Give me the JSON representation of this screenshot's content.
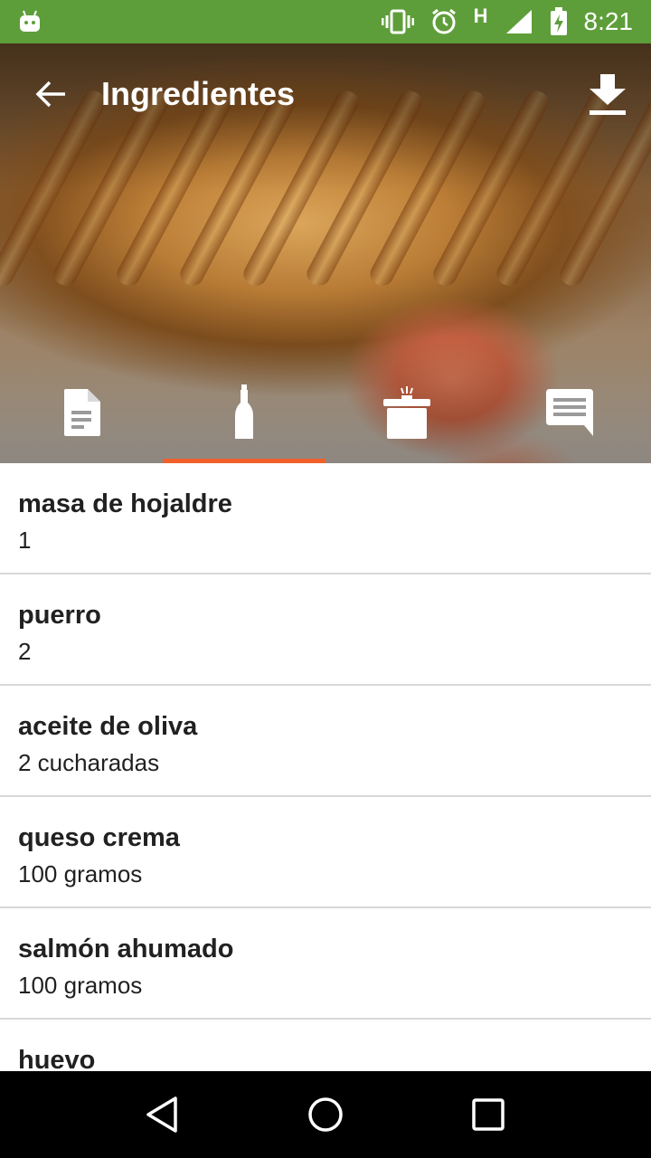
{
  "status_bar": {
    "time": "8:21",
    "network_label": "H",
    "icons": [
      "android-icon",
      "vibrate-icon",
      "alarm-icon",
      "signal-icon",
      "battery-charging-icon"
    ],
    "background_color": "#5e9e3a"
  },
  "toolbar": {
    "title": "Ingredientes",
    "back_icon": "arrow-back-icon",
    "download_icon": "download-icon"
  },
  "tabs": [
    {
      "id": "description",
      "icon": "document-icon",
      "active": false
    },
    {
      "id": "ingredients",
      "icon": "bottle-icon",
      "active": true
    },
    {
      "id": "cooking",
      "icon": "pot-icon",
      "active": false
    },
    {
      "id": "comments",
      "icon": "comment-icon",
      "active": false
    }
  ],
  "accent_color": "#f0602a",
  "ingredients": [
    {
      "name": "masa de hojaldre",
      "quantity": "1"
    },
    {
      "name": "puerro",
      "quantity": "2"
    },
    {
      "name": "aceite de oliva",
      "quantity": "2 cucharadas"
    },
    {
      "name": "queso crema",
      "quantity": "100 gramos"
    },
    {
      "name": "salmón ahumado",
      "quantity": "100 gramos"
    },
    {
      "name": "huevo",
      "quantity": ""
    }
  ],
  "nav_bar": {
    "icons": [
      "back-triangle-icon",
      "home-circle-icon",
      "recents-square-icon"
    ]
  }
}
